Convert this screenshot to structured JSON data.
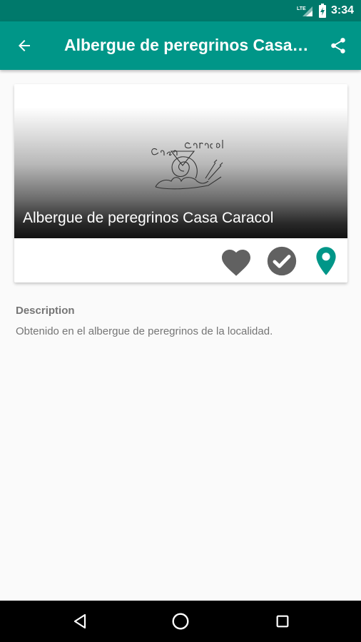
{
  "status_bar": {
    "time": "3:34",
    "network": "LTE"
  },
  "app_bar": {
    "title": "Albergue de peregrinos Casa Caracol",
    "back_icon": "arrow-back-icon",
    "share_icon": "share-icon"
  },
  "card": {
    "title": "Albergue de peregrinos Casa Caracol",
    "image_label": "Casa Caracol",
    "actions": [
      {
        "name": "favorite",
        "icon": "heart-icon",
        "color": "#616161"
      },
      {
        "name": "visited",
        "icon": "check-circle-icon",
        "color": "#616161"
      },
      {
        "name": "map",
        "icon": "map-pin-icon",
        "color": "#009688"
      }
    ]
  },
  "description": {
    "label": "Description",
    "text": "Obtenido en el albergue de peregrinos de la localidad."
  },
  "colors": {
    "primary": "#009688",
    "primary_dark": "#00796b",
    "icon_grey": "#616161",
    "text_grey": "#757575"
  }
}
